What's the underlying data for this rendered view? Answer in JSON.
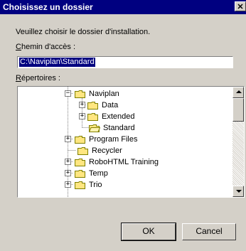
{
  "window": {
    "title": "Choisissez un dossier",
    "close_label": "✕"
  },
  "dialog": {
    "prompt": "Veuillez choisir le dossier d'installation.",
    "path_label": "Chemin d'accès :",
    "path_value": "C:\\Naviplan\\Standard",
    "dirs_label": "Répertoires :"
  },
  "tree": [
    {
      "label": "Naviplan",
      "toggle": "−"
    },
    {
      "label": "Data",
      "toggle": "+"
    },
    {
      "label": "Extended",
      "toggle": "+"
    },
    {
      "label": "Standard",
      "toggle": ""
    },
    {
      "label": "Program Files",
      "toggle": "+"
    },
    {
      "label": "Recycler",
      "toggle": ""
    },
    {
      "label": "RoboHTML Training",
      "toggle": "+"
    },
    {
      "label": "Temp",
      "toggle": "+"
    },
    {
      "label": "Trio",
      "toggle": "+"
    }
  ],
  "buttons": {
    "ok": "OK",
    "cancel": "Cancel"
  },
  "colors": {
    "titlebar": "#000080",
    "selection": "#000080",
    "face": "#d4d0c8",
    "folder": "#ffe680"
  }
}
